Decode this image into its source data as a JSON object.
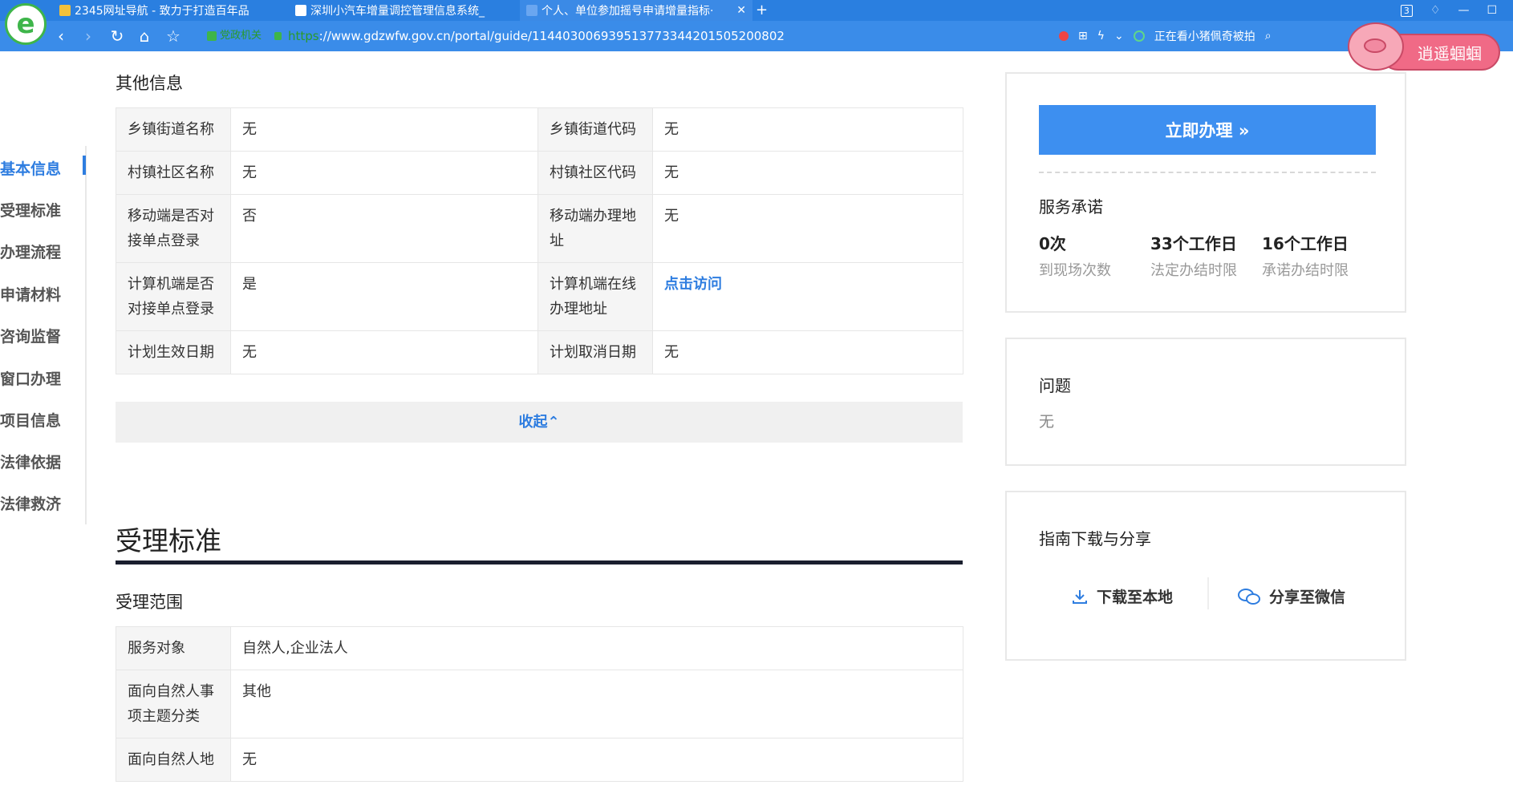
{
  "browser": {
    "tabs": [
      {
        "label": "2345网址导航 - 致力于打造百年品"
      },
      {
        "label": "深圳小汽车增量调控管理信息系统_"
      },
      {
        "label": "个人、单位参加摇号申请增量指标·"
      }
    ],
    "new_tab_symbol": "+",
    "tab_count_badge": "3",
    "address": {
      "site_tag": "党政机关",
      "protocol": "https",
      "url_rest": "://www.gdzwfw.gov.cn/portal/guide/11440300693951377334420150520080​2"
    },
    "news_ticker": "正在看小猪佩奇被拍",
    "mascot_label": "逍遥蝈蝈"
  },
  "sidenav": {
    "items": [
      {
        "label": "基本信息"
      },
      {
        "label": "受理标准"
      },
      {
        "label": "办理流程"
      },
      {
        "label": "申请材料"
      },
      {
        "label": "咨询监督"
      },
      {
        "label": "窗口办理"
      },
      {
        "label": "项目信息"
      },
      {
        "label": "法律依据"
      },
      {
        "label": "法律救济"
      }
    ]
  },
  "other_info": {
    "title": "其他信息",
    "rows": [
      {
        "k1": "乡镇街道名称",
        "v1": "无",
        "k2": "乡镇街道代码",
        "v2": "无"
      },
      {
        "k1": "村镇社区名称",
        "v1": "无",
        "k2": "村镇社区代码",
        "v2": "无"
      },
      {
        "k1": "移动端是否对接单点登录",
        "v1": "否",
        "k2": "移动端办理地址",
        "v2": "无"
      },
      {
        "k1": "计算机端是否对接单点登录",
        "v1": "是",
        "k2": "计算机端在线办理地址",
        "v2": "点击访问"
      },
      {
        "k1": "计划生效日期",
        "v1": "无",
        "k2": "计划取消日期",
        "v2": "无"
      }
    ],
    "collapse_label": "收起⌃"
  },
  "standard": {
    "title": "受理标准",
    "scope_title": "受理范围",
    "rows": [
      {
        "k": "服务对象",
        "v": "自然人,企业法人"
      },
      {
        "k": "面向自然人事项主题分类",
        "v": "其他"
      },
      {
        "k": "面向自然人地",
        "v": "无"
      }
    ]
  },
  "right": {
    "handle_button": "立即办理 »",
    "promise_title": "服务承诺",
    "promises": [
      {
        "value": "0次",
        "label": "到现场次数"
      },
      {
        "value": "33个工作日",
        "label": "法定办结时限"
      },
      {
        "value": "16个工作日",
        "label": "承诺办结时限"
      }
    ],
    "question_title": "问题",
    "question_text": "无",
    "download_title": "指南下载与分享",
    "download_local": "下载至本地",
    "share_wechat": "分享至微信"
  },
  "colors": {
    "accent": "#2e7de0",
    "button": "#3d8ff0",
    "browser_bar": "#3a8ce9",
    "table_key_bg": "#f5f5f5"
  }
}
